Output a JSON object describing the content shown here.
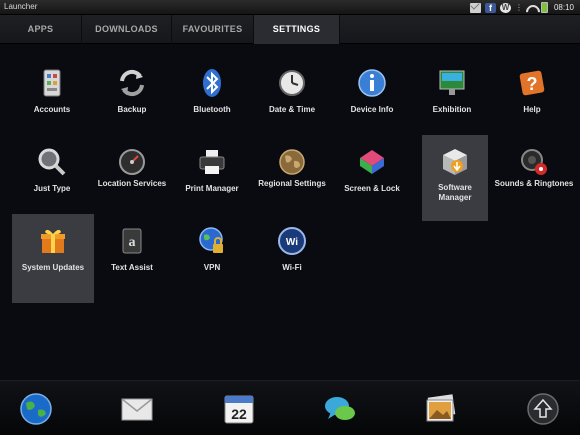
{
  "status_bar": {
    "app_title": "Launcher",
    "clock": "08:10",
    "icons": [
      "mail-icon",
      "facebook-icon",
      "wordpress-icon",
      "more-icon",
      "wifi-icon",
      "battery-icon"
    ]
  },
  "tabs": [
    {
      "label": "APPS",
      "active": false
    },
    {
      "label": "DOWNLOADS",
      "active": false
    },
    {
      "label": "FAVOURITES",
      "active": false
    },
    {
      "label": "SETTINGS",
      "active": true
    }
  ],
  "settings": {
    "items": [
      {
        "label": "Accounts",
        "icon": "accounts-icon"
      },
      {
        "label": "Backup",
        "icon": "backup-icon"
      },
      {
        "label": "Bluetooth",
        "icon": "bluetooth-icon"
      },
      {
        "label": "Date & Time",
        "icon": "clock-icon"
      },
      {
        "label": "Device Info",
        "icon": "info-icon"
      },
      {
        "label": "Exhibition",
        "icon": "exhibition-icon"
      },
      {
        "label": "Help",
        "icon": "help-icon"
      },
      {
        "label": "Just Type",
        "icon": "magnifier-icon"
      },
      {
        "label": "Location Services",
        "icon": "gauge-icon"
      },
      {
        "label": "Print Manager",
        "icon": "printer-icon"
      },
      {
        "label": "Regional Settings",
        "icon": "globe-icon"
      },
      {
        "label": "Screen & Lock",
        "icon": "color-cube-icon"
      },
      {
        "label": "Software Manager",
        "icon": "software-box-icon",
        "selected": true
      },
      {
        "label": "Sounds & Ringtones",
        "icon": "speaker-icon"
      },
      {
        "label": "System Updates",
        "icon": "gift-box-icon",
        "selected": true
      },
      {
        "label": "Text Assist",
        "icon": "text-assist-icon"
      },
      {
        "label": "VPN",
        "icon": "vpn-lock-icon"
      },
      {
        "label": "Wi-Fi",
        "icon": "wifi-settings-icon"
      }
    ]
  },
  "dock": {
    "items": [
      {
        "name": "web-browser",
        "icon": "globe-icon"
      },
      {
        "name": "email",
        "icon": "envelope-icon"
      },
      {
        "name": "calendar",
        "icon": "calendar-icon",
        "text": "22"
      },
      {
        "name": "messaging",
        "icon": "chat-bubbles-icon"
      },
      {
        "name": "photos",
        "icon": "photos-icon"
      },
      {
        "name": "launcher",
        "icon": "launcher-arrow-icon"
      }
    ]
  },
  "colors": {
    "background": "#0a0b10",
    "selected_tile": "#3a3c42",
    "active_tab": "#2a2c31"
  }
}
